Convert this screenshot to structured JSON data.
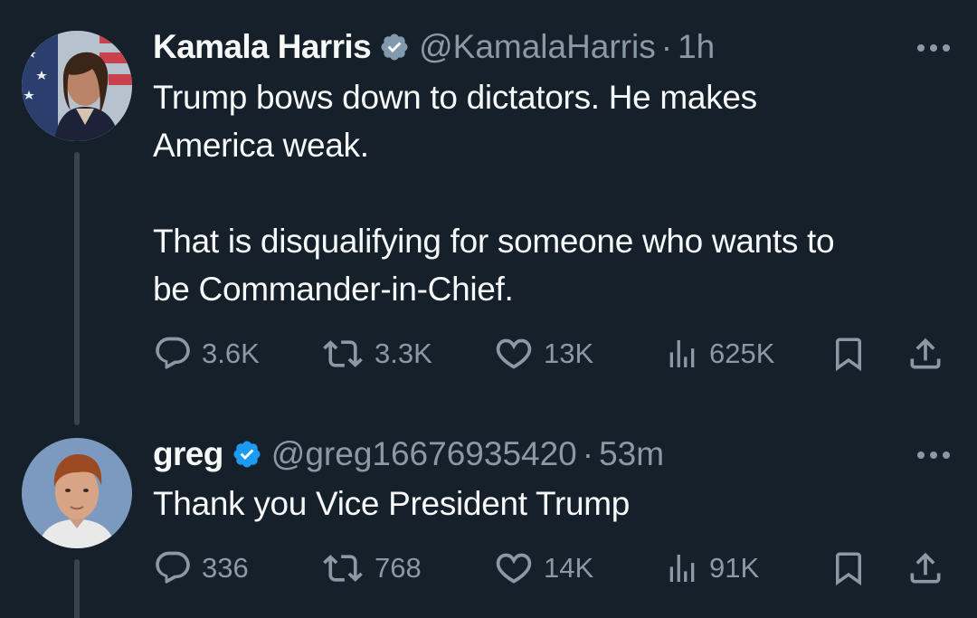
{
  "tweets": [
    {
      "author_name": "Kamala Harris",
      "handle": "@KamalaHarris",
      "separator": "·",
      "time": "1h",
      "text_paragraphs": [
        "Trump bows down to dictators. He makes America weak.",
        "That is disqualifying for someone who wants to be Commander-in-Chief."
      ],
      "text_lines": [
        "Trump bows down to dictators. He makes",
        "America weak.",
        "",
        "That is disqualifying for someone who wants to",
        "be Commander-in-Chief."
      ],
      "replies": "3.6K",
      "reposts": "3.3K",
      "likes": "13K",
      "views": "625K",
      "verified": true
    },
    {
      "author_name": "greg",
      "handle": "@greg16676935420",
      "separator": "·",
      "time": "53m",
      "text_lines": [
        "Thank you Vice President Trump"
      ],
      "replies": "336",
      "reposts": "768",
      "likes": "14K",
      "views": "91K",
      "verified": true
    }
  ],
  "icons": {
    "verified": "verified-badge-icon",
    "more": "more-options-icon",
    "reply": "reply-bubble-icon",
    "repost": "repost-arrows-icon",
    "like": "heart-icon",
    "views": "bar-chart-icon",
    "bookmark": "bookmark-icon",
    "share": "share-upload-icon"
  },
  "colors": {
    "background": "#15202b",
    "text": "#f7f9f9",
    "muted": "#8b98a5",
    "thread_line": "#38444d",
    "verified_blue": "#1d9bf0",
    "verified_gray": "#829aab"
  }
}
